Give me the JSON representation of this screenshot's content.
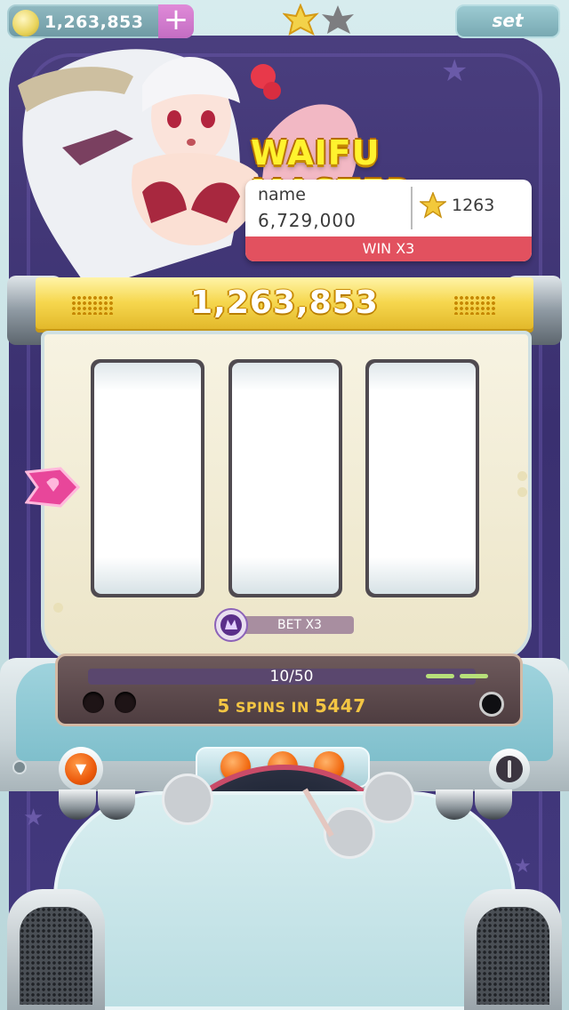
{
  "top_bar": {
    "coins": "1,263,853",
    "add_label": "+",
    "settings_label": "set"
  },
  "header": {
    "title": "WAIFU MASTER"
  },
  "player_card": {
    "name_label": "name",
    "score": "6,729,000",
    "stars": "1263",
    "win_label": "WIN X3"
  },
  "jackpot": {
    "value": "1,263,853"
  },
  "reels": {
    "count": 3
  },
  "bet": {
    "label": "BET X3"
  },
  "console": {
    "progress_text": "10/50",
    "progress_current": 10,
    "progress_total": 50,
    "spins_count": "5",
    "spins_middle": "SPINS IN",
    "spins_timer": "5447"
  },
  "colors": {
    "gold": "#f6d74e",
    "title_yellow": "#fff32e",
    "win_red": "#e2515f",
    "cabinet_purple": "#3a3070",
    "button_orange": "#f26b12",
    "add_pink": "#c36dc3"
  },
  "icons": {
    "coin": "coin-icon",
    "star": "star-icon",
    "pointer": "heart-pointer-icon",
    "bet": "bet-emblem-icon"
  }
}
